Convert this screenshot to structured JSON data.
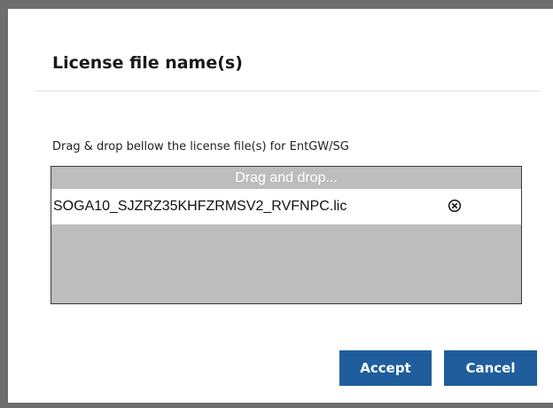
{
  "dialog": {
    "title": "License file name(s)",
    "instruction": "Drag & drop bellow the license file(s) for EntGW/SG",
    "dropzone": {
      "placeholder": "Drag and drop...",
      "files": [
        {
          "name": "SOGA10_SJZRZ35KHFZRMSV2_RVFNPC.lic",
          "remove_icon": "close-circle-icon"
        }
      ]
    },
    "buttons": {
      "accept_label": "Accept",
      "cancel_label": "Cancel"
    }
  },
  "colors": {
    "backdrop": "#6e6e6e",
    "dialog_background": "#ffffff",
    "dropzone_background": "#bdbdbd",
    "button_primary": "#1f5d9c",
    "button_text": "#ffffff"
  }
}
